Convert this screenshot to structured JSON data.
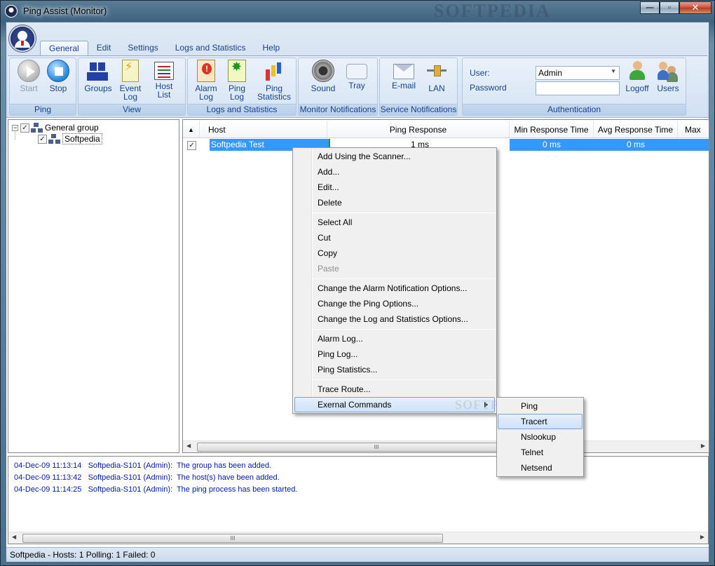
{
  "window": {
    "title": "Ping Assist  (Monitor)",
    "watermark": "SOFTPEDIA",
    "buttons": {
      "minimize": "—",
      "maximize": "▫",
      "close": "✕"
    }
  },
  "ribbon": {
    "tabs": [
      "General",
      "Edit",
      "Settings",
      "Logs and Statistics",
      "Help"
    ],
    "active_tab": "General",
    "groups": {
      "ping": {
        "label": "Ping",
        "start": "Start",
        "stop": "Stop"
      },
      "view": {
        "label": "View",
        "groups": "Groups",
        "event_log_1": "Event",
        "event_log_2": "Log",
        "host_list_1": "Host",
        "host_list_2": "List"
      },
      "logs": {
        "label": "Logs and Statistics",
        "alarm_log_1": "Alarm",
        "alarm_log_2": "Log",
        "ping_log_1": "Ping",
        "ping_log_2": "Log",
        "ping_stats_1": "Ping",
        "ping_stats_2": "Statistics"
      },
      "monitor": {
        "label": "Monitor Notifications",
        "sound": "Sound",
        "tray": "Tray"
      },
      "service": {
        "label": "Service Notifications",
        "email": "E-mail",
        "lan": "LAN"
      },
      "auth": {
        "label": "Authentication",
        "user_label": "User:",
        "password_label": "Password",
        "user_value": "Admin",
        "logoff": "Logoff",
        "users": "Users"
      }
    }
  },
  "tree": {
    "root": {
      "label": "General group",
      "expander": "−",
      "checked": "✓"
    },
    "child": {
      "label": "Softpedia",
      "checked": "✓"
    }
  },
  "host_list": {
    "sort_indicator": "▲",
    "columns": [
      "Host",
      "Ping Response",
      "Min Response Time",
      "Avg Response Time",
      "Max Re"
    ],
    "rows": [
      {
        "checked": "✓",
        "host": "Softpedia Test",
        "ping_response": "1 ms",
        "min": "0 ms",
        "avg": "0 ms"
      }
    ],
    "scroll_grip": "III",
    "arrow_left": "◀",
    "arrow_right": "▶"
  },
  "context_menu": {
    "items": [
      "Add Using the Scanner...",
      "Add...",
      "Edit...",
      "Delete",
      "Select All",
      "Cut",
      "Copy",
      "Paste",
      "Change the Alarm Notification Options...",
      "Change the Ping Options...",
      "Change the Log and Statistics Options...",
      "Alarm Log...",
      "Ping Log...",
      "Ping Statistics...",
      "Trace Route...",
      "Exernal Commands"
    ],
    "watermark": "SOFTPEDIA"
  },
  "submenu": {
    "items": [
      "Ping",
      "Tracert",
      "Nslookup",
      "Telnet",
      "Netsend"
    ],
    "highlighted": "Tracert"
  },
  "log": {
    "lines": [
      "04-Dec-09 11:13:14   Softpedia-S101 (Admin):  The group has been added.",
      "04-Dec-09 11:13:42   Softpedia-S101 (Admin):  The host(s) have been added.",
      "04-Dec-09 11:14:25   Softpedia-S101 (Admin):  The ping process has been started."
    ],
    "scroll_grip": "III"
  },
  "status": {
    "text": "Softpedia -    Hosts: 1   Polling: 1   Failed: 0"
  }
}
